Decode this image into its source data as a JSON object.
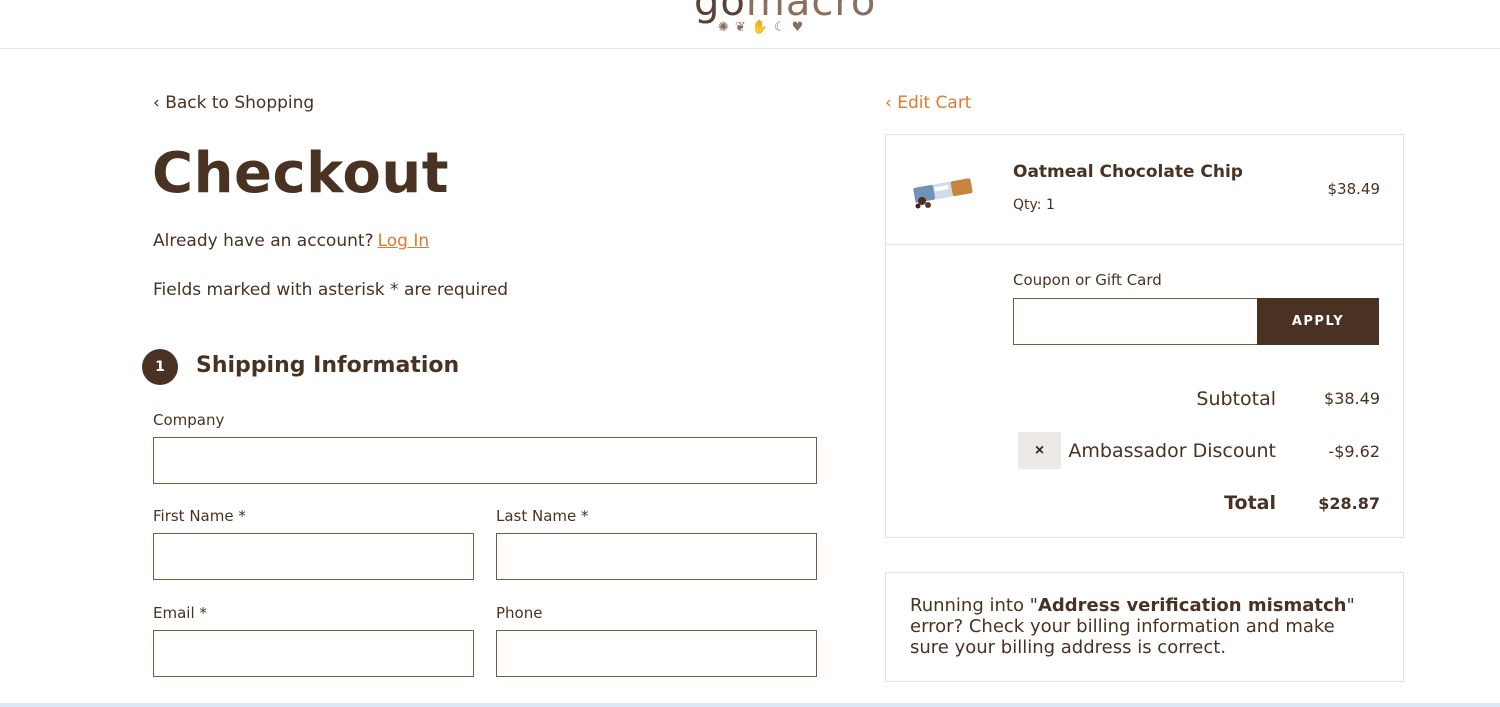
{
  "header": {
    "logo_go": "go",
    "logo_macro": "macro"
  },
  "checkout": {
    "back_link": "‹ Back to Shopping",
    "title": "Checkout",
    "account_prompt": "Already have an account?",
    "login_link": "Log In",
    "required_note": "Fields marked with asterisk * are required",
    "step_number": "1",
    "section_title": "Shipping Information",
    "fields": {
      "company": {
        "label": "Company",
        "value": ""
      },
      "first_name": {
        "label": "First Name *",
        "value": ""
      },
      "last_name": {
        "label": "Last Name *",
        "value": ""
      },
      "email": {
        "label": "Email *",
        "value": ""
      },
      "phone": {
        "label": "Phone",
        "value": ""
      }
    }
  },
  "cart": {
    "edit_link": "‹ Edit Cart",
    "item": {
      "name": "Oatmeal Chocolate Chip",
      "qty": "Qty: 1",
      "price": "$38.49"
    },
    "coupon": {
      "label": "Coupon or Gift Card",
      "value": "",
      "apply_label": "APPLY"
    },
    "summary": {
      "subtotal_label": "Subtotal",
      "subtotal_value": "$38.49",
      "discount_label": "Ambassador Discount",
      "discount_value": "-$9.62",
      "remove_icon": "×",
      "total_label": "Total",
      "total_value": "$28.87"
    }
  },
  "notice": {
    "prefix": "Running into \"",
    "bold": "Address verification mismatch",
    "suffix": "\" error? Check your billing information and make sure your billing address is correct."
  },
  "colors": {
    "brown": "#4a3222",
    "accent_orange": "#e07a2c",
    "border": "#e6e1dc"
  }
}
